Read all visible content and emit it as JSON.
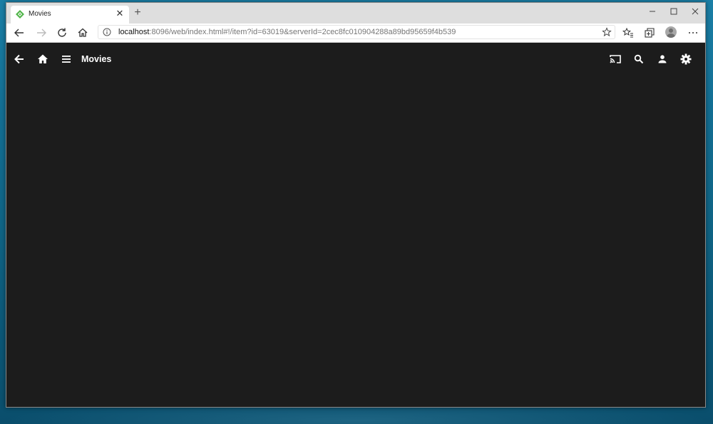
{
  "browser": {
    "tab": {
      "title": "Movies",
      "favicon": "jellyfin-emby-favicon"
    },
    "url": {
      "host": "localhost",
      "path": ":8096/web/index.html#!/item?id=63019&serverId=2cec8fc010904288a89bd95659f4b539"
    },
    "window_controls": [
      "minimize",
      "maximize",
      "close"
    ]
  },
  "app": {
    "title": "Movies",
    "left_icons": [
      "back-arrow-icon",
      "home-icon",
      "menu-icon"
    ],
    "right_icons": [
      "cast-icon",
      "search-icon",
      "user-icon",
      "settings-icon"
    ]
  },
  "colors": {
    "app_background": "#1c1c1c",
    "favicon_green": "#52b54b",
    "desktop": "#136f94"
  }
}
